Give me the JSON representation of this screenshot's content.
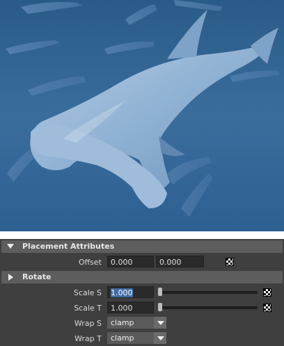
{
  "viewport": {
    "image_description_icon": "hammerhead-shark-texture-preview"
  },
  "panel": {
    "placement_section": {
      "title": "Placement Attributes",
      "expanded": true
    },
    "offset": {
      "label": "Offset",
      "value_u": "0.000",
      "value_v": "0.000"
    },
    "rotate_section": {
      "title": "Rotate",
      "expanded": false
    },
    "scale_s": {
      "label": "Scale S",
      "value": "1.000",
      "slider_level": 0
    },
    "scale_t": {
      "label": "Scale T",
      "value": "1.000",
      "slider_level": 0
    },
    "wrap_s": {
      "label": "Wrap S",
      "value": "clamp"
    },
    "wrap_t": {
      "label": "Wrap T",
      "value": "clamp"
    }
  },
  "colors": {
    "panel_bg": "#3f3f3f",
    "header_bg": "#5d5d5d",
    "field_bg": "#2a2a2a",
    "selection": "#3e6da3",
    "water": "#2c5f8e"
  }
}
